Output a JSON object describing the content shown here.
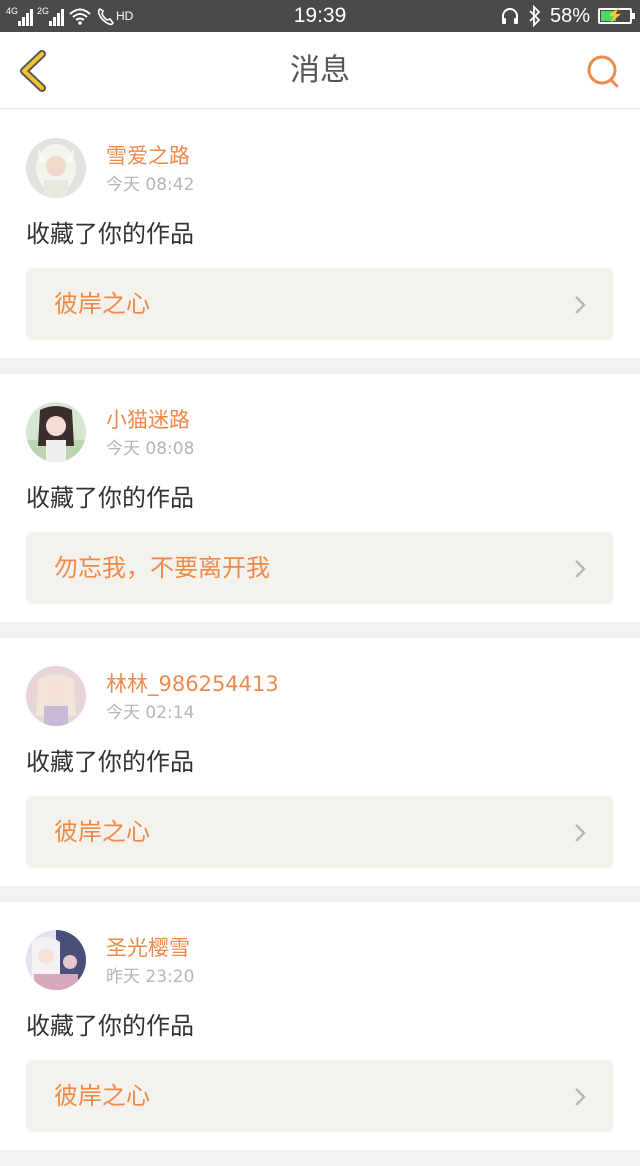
{
  "status_bar": {
    "network_1": "4G",
    "network_2": "2G",
    "hd": "HD",
    "time": "19:39",
    "battery": "58%",
    "battery_level": 0.58
  },
  "header": {
    "title": "消息",
    "back_icon": "back-chevron-icon",
    "search_icon": "search-icon"
  },
  "messages": [
    {
      "user": "雪爱之路",
      "time": "今天 08:42",
      "action": "收藏了你的作品",
      "work": "彼岸之心"
    },
    {
      "user": "小猫迷路",
      "time": "今天 08:08",
      "action": "收藏了你的作品",
      "work": "勿忘我，不要离开我"
    },
    {
      "user": "林林_986254413",
      "time": "今天 02:14",
      "action": "收藏了你的作品",
      "work": "彼岸之心"
    },
    {
      "user": "圣光樱雪",
      "time": "昨天 23:20",
      "action": "收藏了你的作品",
      "work": "彼岸之心"
    }
  ],
  "colors": {
    "accent": "#f08a4b",
    "back_icon": "#f2c230",
    "work_box_bg": "#f3f2ec",
    "status_bar_bg": "#4a4a4a"
  }
}
